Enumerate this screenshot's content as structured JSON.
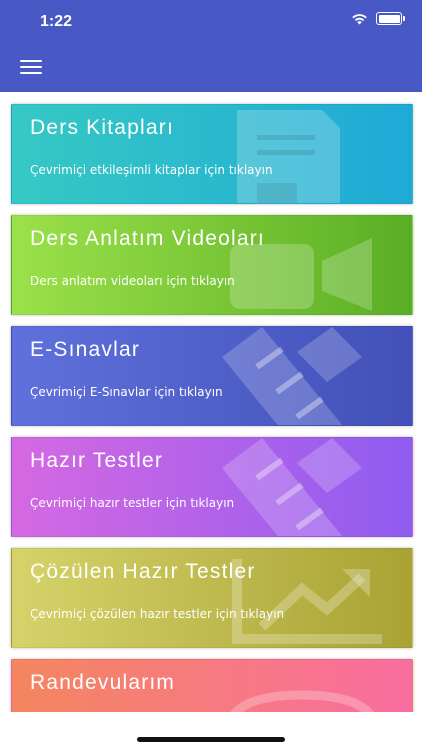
{
  "status_bar": {
    "time": "1:22"
  },
  "cards": [
    {
      "title": "Ders Kitapları",
      "subtitle": "Çevrimiçi etkileşimli kitaplar için tıklayın",
      "icon": "book-icon",
      "gradient": [
        "#36c9c4",
        "#1fa9d6"
      ]
    },
    {
      "title": "Ders Anlatım Videoları",
      "subtitle": "Ders anlatım videoları için tıklayın",
      "icon": "video-camera-icon",
      "gradient": [
        "#9be14a",
        "#5aae25"
      ]
    },
    {
      "title": "E-Sınavlar",
      "subtitle": "Çevrimiçi E-Sınavlar için tıklayın",
      "icon": "pencil-ruler-icon",
      "gradient": [
        "#5f71dc",
        "#4250b8"
      ]
    },
    {
      "title": "Hazır Testler",
      "subtitle": "Çevrimiçi hazır testler için tıklayın",
      "icon": "pencil-ruler-icon",
      "gradient": [
        "#d569e2",
        "#8f5cf0"
      ]
    },
    {
      "title": "Çözülen Hazır Testler",
      "subtitle": "Çevrimiçi çözülen hazır testler için tıklayın",
      "icon": "trend-chart-icon",
      "gradient": [
        "#d5d36a",
        "#a9a234"
      ]
    },
    {
      "title": "Randevularım",
      "subtitle": "",
      "icon": "phone-icon",
      "gradient": [
        "#f4865f",
        "#f96ea0"
      ]
    }
  ]
}
